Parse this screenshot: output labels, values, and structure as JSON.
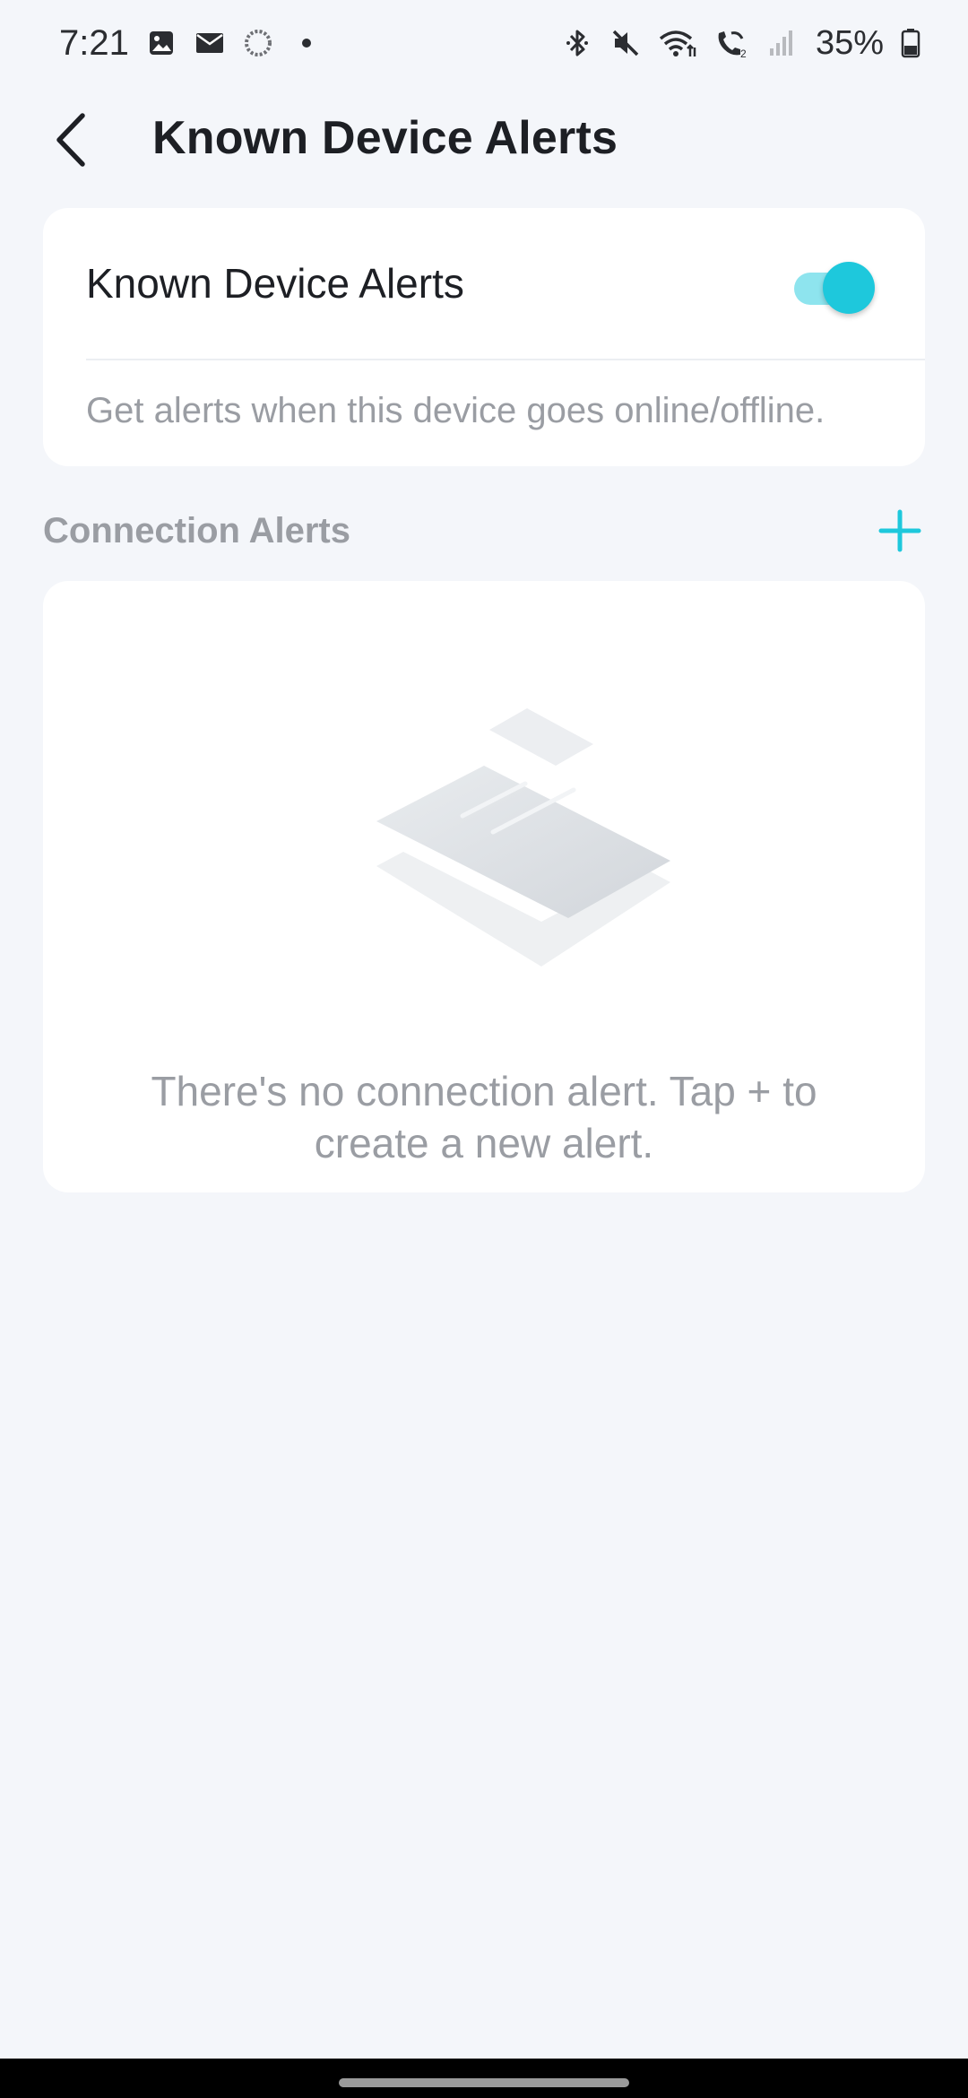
{
  "status_bar": {
    "time": "7:21",
    "battery": "35%",
    "left_icons": [
      "gallery-icon",
      "mail-icon",
      "sync-icon",
      "dot-icon"
    ],
    "right_icons": [
      "bluetooth-icon",
      "mute-icon",
      "wifi-icon",
      "wifi-calling-icon",
      "signal-icon",
      "battery-icon"
    ]
  },
  "header": {
    "title": "Known Device Alerts",
    "back_icon": "back-arrow-icon"
  },
  "known_device_card": {
    "label": "Known Device Alerts",
    "toggle_on": true,
    "description": "Get alerts when this device goes online/offline."
  },
  "connection_alerts": {
    "title": "Connection Alerts",
    "add_icon": "plus-icon",
    "empty_message": "There's no connection alert. Tap + to create a new alert."
  },
  "colors": {
    "accent": "#1ec8dc",
    "accent_light": "#8ee4ee",
    "background": "#f4f6fa",
    "muted_text": "#9a9da3"
  }
}
